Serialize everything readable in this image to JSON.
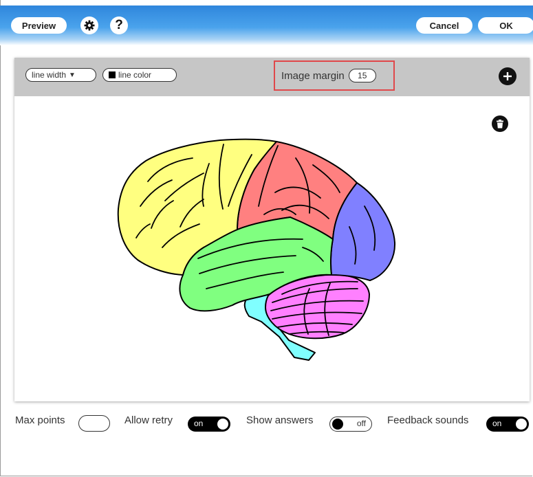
{
  "header": {
    "preview_label": "Preview",
    "cancel_label": "Cancel",
    "ok_label": "OK",
    "settings_icon": "gear-icon",
    "help_icon": "question-icon"
  },
  "toolbar": {
    "line_width_label": "line width",
    "line_color_label": "line color",
    "image_margin_label": "Image margin",
    "image_margin_value": "15",
    "add_icon": "plus-icon",
    "delete_icon": "trash-icon"
  },
  "options": {
    "max_points_label": "Max points",
    "max_points_value": "",
    "allow_retry_label": "Allow retry",
    "allow_retry_state": "on",
    "show_answers_label": "Show answers",
    "show_answers_state": "off",
    "feedback_sounds_label": "Feedback sounds",
    "feedback_sounds_state": "on"
  },
  "colors": {
    "frontal_lobe": "#ffff80",
    "parietal_lobe": "#ff8080",
    "occipital_lobe": "#8080ff",
    "temporal_lobe": "#80ff80",
    "cerebellum": "#ff80ff",
    "brainstem": "#80ffff",
    "highlight_border": "#e0474a"
  }
}
